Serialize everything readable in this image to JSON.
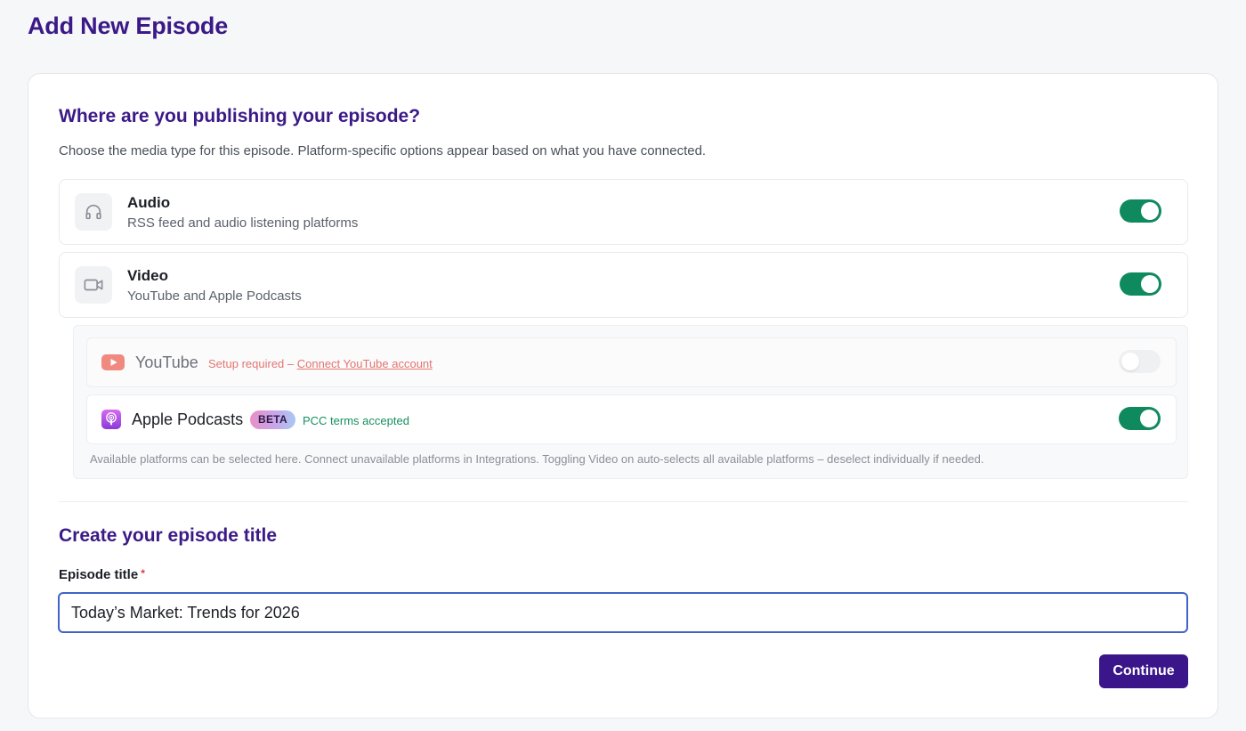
{
  "page": {
    "title": "Add New Episode"
  },
  "publishing": {
    "heading": "Where are you publishing your episode?",
    "description": "Choose the media type for this episode. Platform-specific options appear based on what you have connected.",
    "media_types": [
      {
        "name": "Audio",
        "subtitle": "RSS feed and audio listening platforms",
        "icon": "headphones-icon",
        "enabled": true
      },
      {
        "name": "Video",
        "subtitle": "YouTube and Apple Podcasts",
        "icon": "video-camera-icon",
        "enabled": true
      }
    ],
    "platforms": {
      "youtube": {
        "name": "YouTube",
        "icon": "youtube-icon",
        "status_prefix": "Setup required – ",
        "status_link": "Connect YouTube account",
        "enabled": false
      },
      "apple": {
        "name": "Apple Podcasts",
        "icon": "apple-podcasts-icon",
        "badge": "BETA",
        "status": "PCC terms accepted",
        "enabled": true
      },
      "note": "Available platforms can be selected here. Connect unavailable platforms in Integrations. Toggling Video on auto-selects all available platforms – deselect individually if needed."
    }
  },
  "title_section": {
    "heading": "Create your episode title",
    "field_label": "Episode title",
    "required_mark": "*",
    "value": "Today’s Market: Trends for 2026"
  },
  "actions": {
    "continue_label": "Continue"
  },
  "colors": {
    "brand_purple": "#3b1a87",
    "toggle_on": "#0f8a5f",
    "warning": "#e3756f",
    "success": "#15905f",
    "input_focus": "#3f63c9"
  }
}
